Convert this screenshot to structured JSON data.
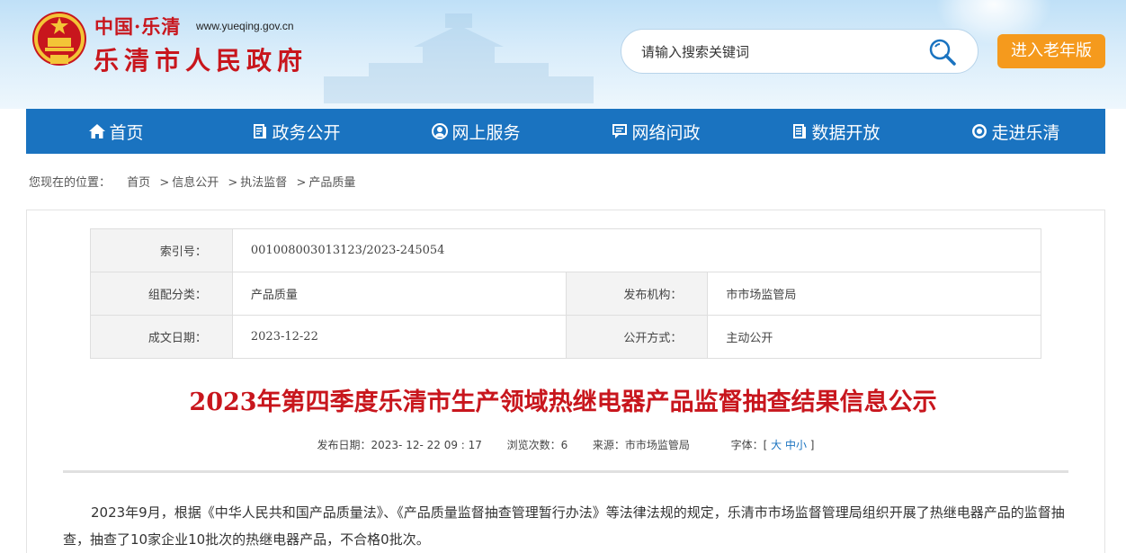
{
  "header": {
    "site_top": "中国·",
    "site_top_red": "乐清",
    "site_url": "www.yueqing.gov.cn",
    "site_name": "乐清市人民政府",
    "search_placeholder": "请输入搜索关键词",
    "elder_mode_label": "进入老年版"
  },
  "nav": {
    "items": [
      {
        "label": "首页",
        "icon": "home-icon"
      },
      {
        "label": "政务公开",
        "icon": "document-icon"
      },
      {
        "label": "网上服务",
        "icon": "service-icon"
      },
      {
        "label": "网络问政",
        "icon": "chat-icon"
      },
      {
        "label": "数据开放",
        "icon": "data-icon"
      },
      {
        "label": "走进乐清",
        "icon": "eye-icon"
      }
    ]
  },
  "breadcrumb": {
    "prefix": "您现在的位置：",
    "items": [
      "首页",
      "信息公开",
      "执法监督",
      "产品质量"
    ]
  },
  "meta": {
    "index_label": "索引号：",
    "index_value": "001008003013123/2023-245054",
    "category_label": "组配分类：",
    "category_value": "产品质量",
    "publisher_label": "发布机构：",
    "publisher_value": "市市场监管局",
    "date_label": "成文日期：",
    "date_value": "2023-12-22",
    "disclosure_label": "公开方式：",
    "disclosure_value": "主动公开"
  },
  "article": {
    "title": "2023年第四季度乐清市生产领域热继电器产品监督抽查结果信息公示",
    "pub_date_label": "发布日期：",
    "pub_date": "2023- 12- 22 09 : 17",
    "views_label": "浏览次数：",
    "views": "6",
    "source_label": "来源：",
    "source": "市市场监管局",
    "font_label": "字体：[",
    "font_large": "大",
    "font_medium": "中",
    "font_small": "小",
    "font_close": "]",
    "paragraph_1": "2023年9月，根据《中华人民共和国产品质量法》、《产品质量监督抽查管理暂行办法》等法律法规的规定，乐清市市场监督管理局组织开展了热继电器产品的监督抽查，抽查了10家企业10批次的热继电器产品，不合格0批次。"
  },
  "colors": {
    "brand_red": "#c8161d",
    "nav_blue": "#1a73c0",
    "elder_orange": "#f59a1d"
  }
}
